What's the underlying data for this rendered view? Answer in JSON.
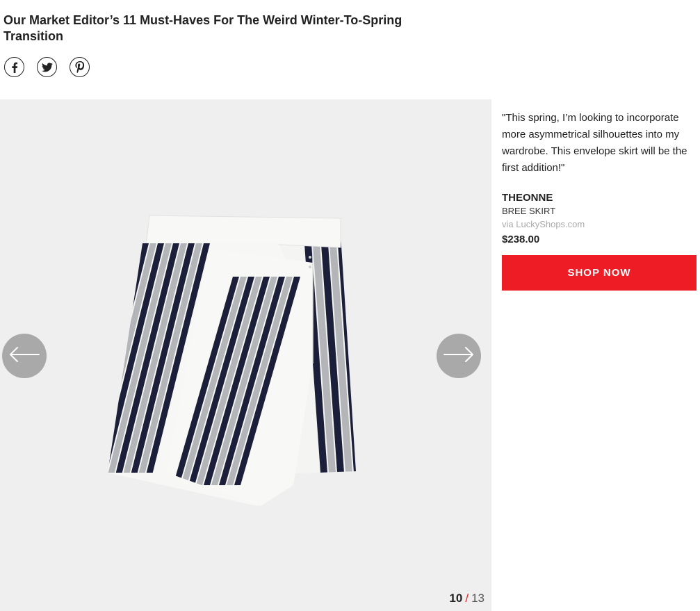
{
  "article": {
    "title": "Our Market Editor’s 11 Must-Haves For The Weird Winter-To-Spring Transition"
  },
  "social": [
    {
      "icon": "facebook-icon"
    },
    {
      "icon": "twitter-icon"
    },
    {
      "icon": "pinterest-icon"
    }
  ],
  "gallery": {
    "current": "10",
    "separator": "/",
    "total": "13",
    "stripe_colors": {
      "navy": "#1c1f3a",
      "gray": "#b3b5b8",
      "white": "#f7f7f5"
    }
  },
  "product": {
    "quote": "\"This spring, I’m looking to incorporate more asymmetrical silhouettes into my wardrobe. This envelope skirt will be the first addition!\"",
    "brand": "THEONNE",
    "name": "BREE SKIRT",
    "source": "via LuckyShops.com",
    "price": "$238.00",
    "cta_label": "SHOP NOW",
    "cta_color": "#ee1c25"
  }
}
